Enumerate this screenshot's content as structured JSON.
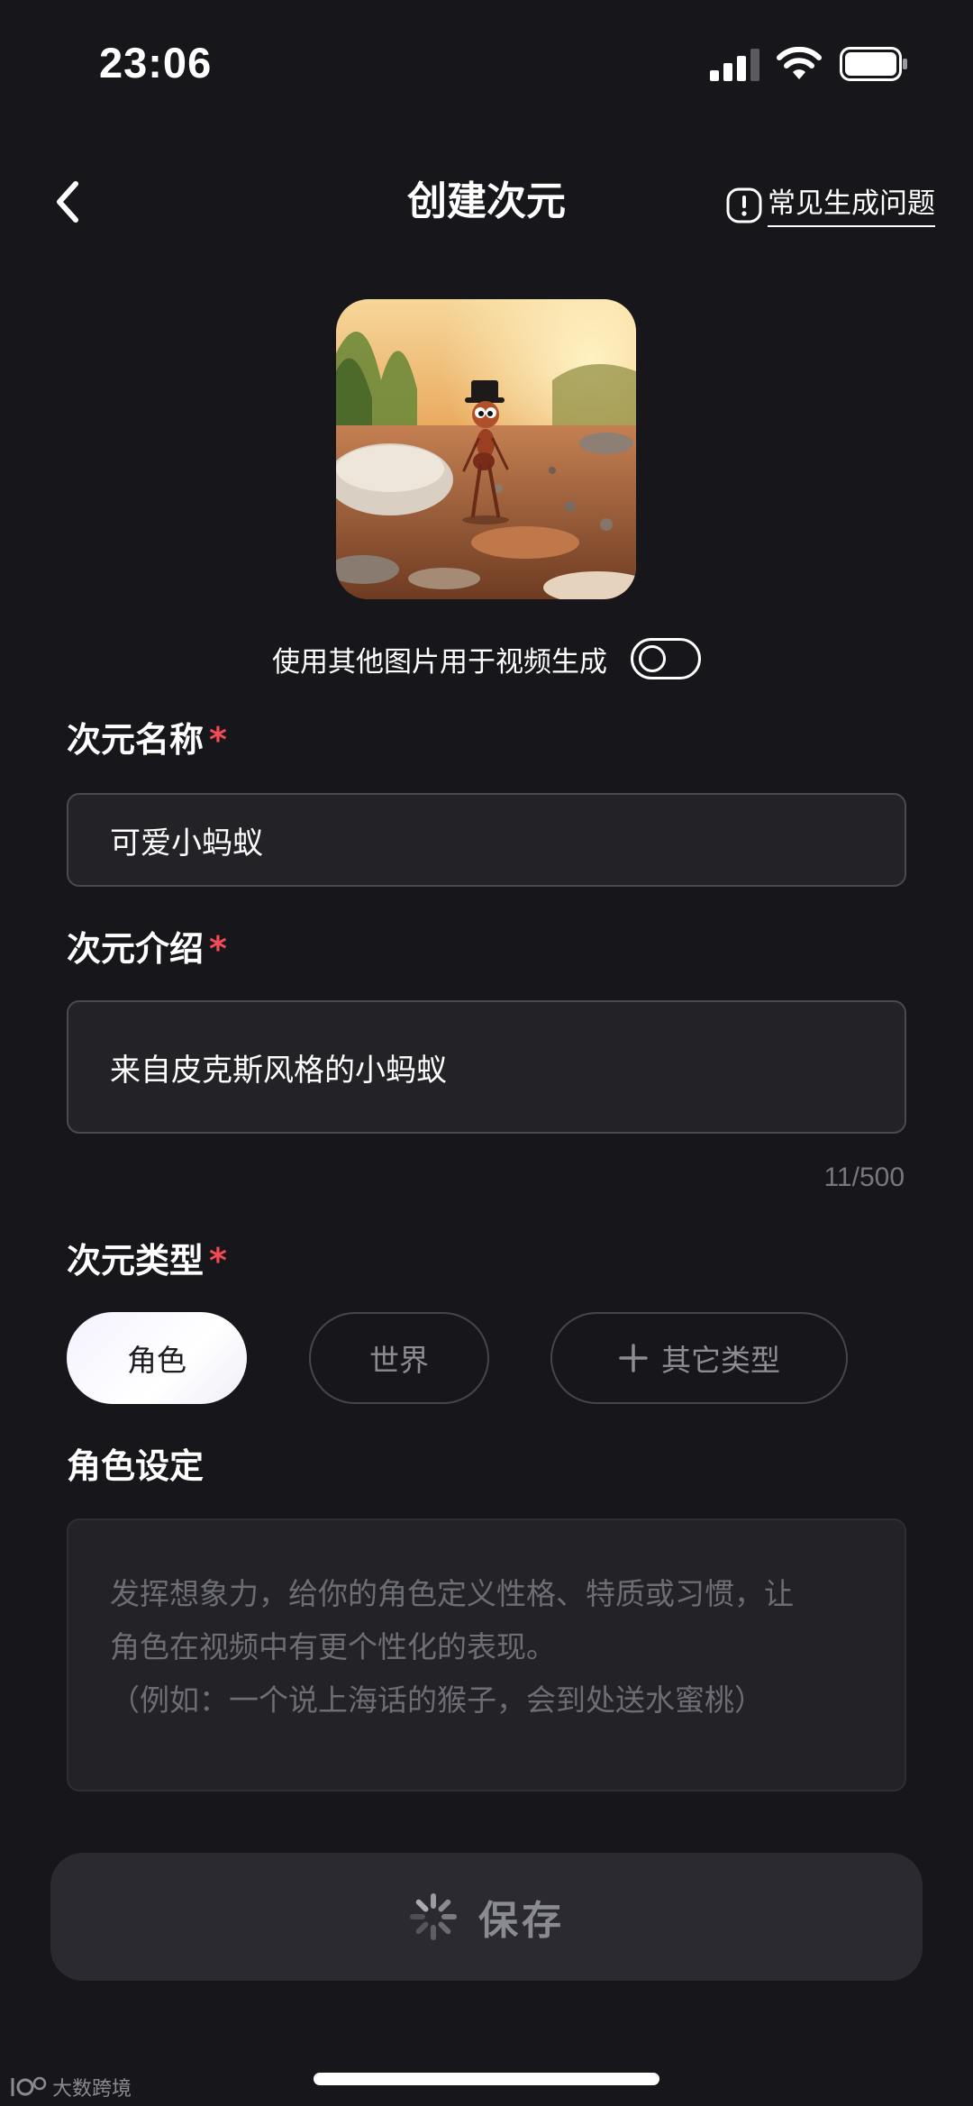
{
  "status_bar": {
    "time": "23:06"
  },
  "header": {
    "title": "创建次元",
    "faq_label": "常见生成问题"
  },
  "cover": {
    "toggle_label": "使用其他图片用于视频生成",
    "toggle_on": false
  },
  "form": {
    "name": {
      "label": "次元名称",
      "required": "*",
      "value": "可爱小蚂蚁"
    },
    "intro": {
      "label": "次元介绍",
      "required": "*",
      "value": "来自皮克斯风格的小蚂蚁",
      "char_count": "11/500"
    },
    "type": {
      "label": "次元类型",
      "required": "*",
      "options": [
        {
          "label": "角色",
          "selected": true
        },
        {
          "label": "世界",
          "selected": false
        },
        {
          "label": "其它类型",
          "selected": false
        }
      ]
    },
    "setting": {
      "label": "角色设定",
      "placeholder_lines": [
        "发挥想象力，给你的角色定义性格、特质或习惯，让",
        "角色在视频中有更个性化的表现。",
        "（例如：一个说上海话的猴子，会到处送水蜜桃）"
      ]
    }
  },
  "save_button": {
    "label": "保存"
  },
  "watermark": {
    "text": "大数跨境"
  },
  "colors": {
    "background": "#17171b",
    "field_background": "#222227",
    "required_star": "#f24a57",
    "muted_text": "#8c8c94"
  },
  "icons": [
    "signal-icon",
    "wifi-icon",
    "battery-icon",
    "back-icon",
    "info-icon",
    "plus-icon",
    "spinner-icon"
  ]
}
